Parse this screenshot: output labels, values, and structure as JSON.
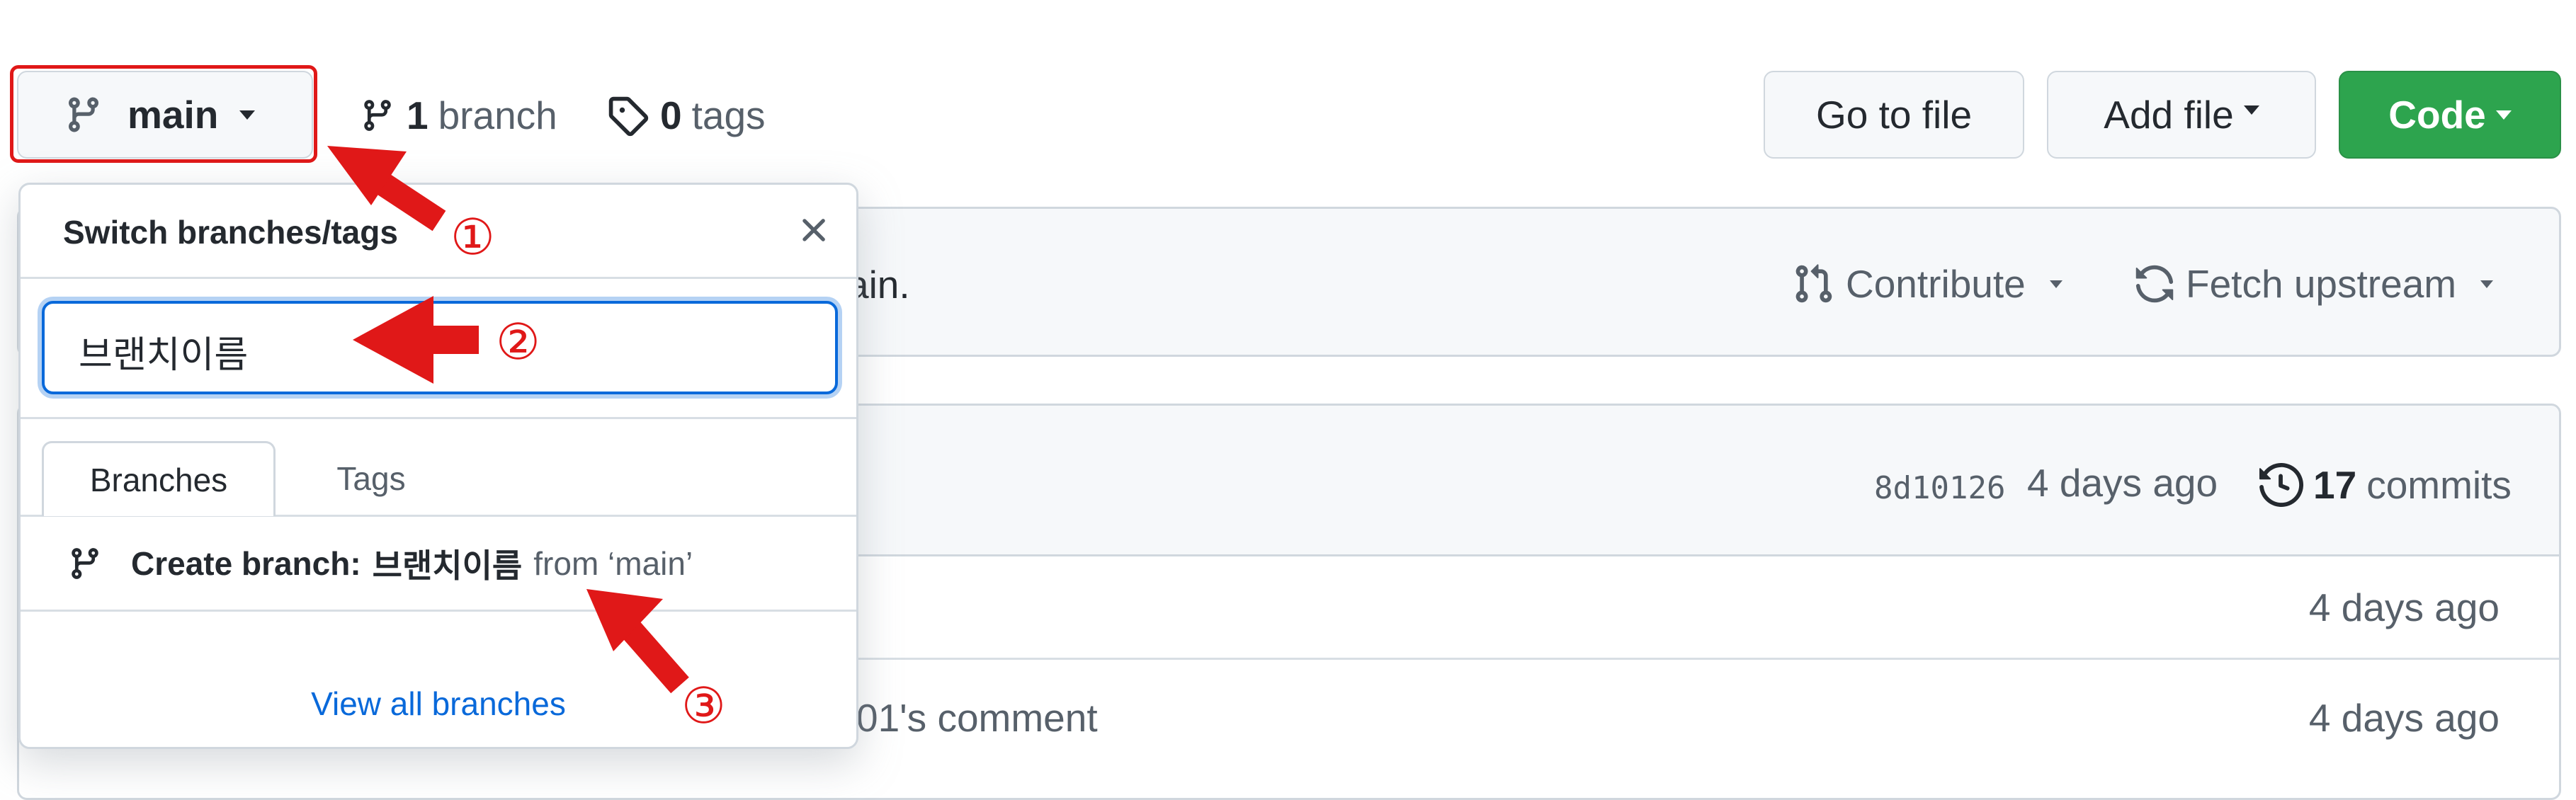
{
  "toolbar": {
    "branch_button_label": "main",
    "branch_count": "1",
    "branch_label": "branch",
    "tag_count": "0",
    "tag_label": "tags",
    "go_to_file": "Go to file",
    "add_file": "Add file",
    "code": "Code"
  },
  "sync_bar": {
    "partial_text": "ain.",
    "contribute": "Contribute",
    "fetch_upstream": "Fetch upstream"
  },
  "commit_bar": {
    "hash": "8d10126",
    "time": "4 days ago",
    "commit_count": "17",
    "commit_label": "commits"
  },
  "file_rows": [
    {
      "message": "",
      "time": "4 days ago"
    },
    {
      "message": "01's comment",
      "time": "4 days ago"
    }
  ],
  "dropdown": {
    "title": "Switch branches/tags",
    "filter_value": "브랜치이름",
    "tabs": [
      {
        "label": "Branches",
        "active": true
      },
      {
        "label": "Tags",
        "active": false
      }
    ],
    "create_prefix": "Create branch:",
    "create_name": "브랜치이름",
    "create_from": "from ‘main’",
    "view_all": "View all branches"
  },
  "annotations": {
    "step1": "①",
    "step2": "②",
    "step3": "③"
  },
  "colors": {
    "code_button": "#2da44e",
    "annotation_red": "#e01818",
    "link_blue": "#0969da",
    "focus_blue": "#0969da"
  },
  "icons": [
    "branch-icon",
    "tag-icon",
    "close-icon",
    "pull-request-icon",
    "sync-icon",
    "history-icon",
    "arrow-icon"
  ]
}
